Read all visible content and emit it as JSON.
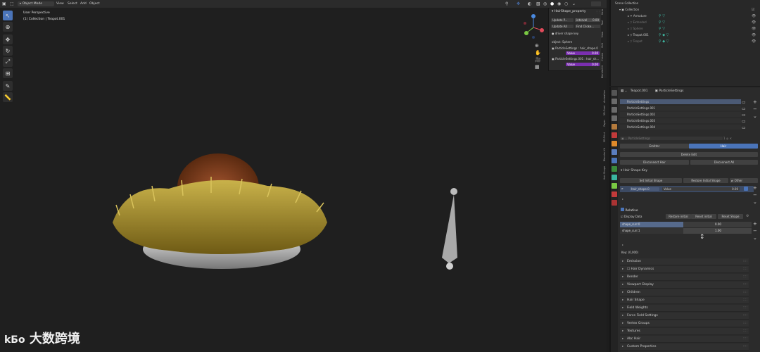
{
  "header": {
    "mode": "Object Mode",
    "menu": [
      "View",
      "Select",
      "Add",
      "Object"
    ]
  },
  "viewport": {
    "perspective": "User Perspective",
    "context": "(1) Collection | Teapot.001",
    "tools": [
      "select-icon",
      "cursor-icon",
      "move-icon",
      "rotate-icon",
      "scale-icon",
      "transform-icon",
      "annotate-icon",
      "measure-icon"
    ]
  },
  "npanel": {
    "title": "HairShape_property",
    "update_btn": "Update P...",
    "interval": "interval",
    "interval_val": "0.00",
    "update_all": "Update All",
    "find_clicked": "Find Clicke...",
    "driver": "driver shape key",
    "object": "object: Sphere",
    "ps1_label": "ParticleSettings : hair_shape.0",
    "value1_label": "Value",
    "value1": "0.00",
    "ps2_label": "ParticleSettings.001 : hair_sh...",
    "value2_label": "Value",
    "value2": "0.00",
    "tabs": [
      "Item",
      "Tool",
      "View",
      "Edit",
      "Create",
      "BlenderKit"
    ]
  },
  "outliner": {
    "scene": "Scene Collection",
    "rows": [
      {
        "name": "Collection",
        "dim": false,
        "indent": 0
      },
      {
        "name": "Armature",
        "dim": false,
        "indent": 1
      },
      {
        "name": "Extended",
        "dim": true,
        "indent": 1
      },
      {
        "name": "Sphere",
        "dim": true,
        "indent": 1
      },
      {
        "name": "Teapot.001",
        "dim": false,
        "indent": 1
      },
      {
        "name": "Teapot",
        "dim": true,
        "indent": 1
      }
    ]
  },
  "properties": {
    "object": "Teapot.001",
    "data": "ParticleSettings",
    "psys": [
      "ParticleSettings",
      "ParticleSettings.001",
      "ParticleSettings.002",
      "ParticleSettings.003",
      "ParticleSettings.004"
    ],
    "settings_name": "ParticleSettings",
    "emitter": "Emitter",
    "hair": "Hair",
    "delete_edit": "Delete Edit",
    "disconnect_hair": "Disconnect Hair",
    "disconnect_all": "Disconnect All",
    "hair_shape_key": "Hair Shape Key",
    "set_initial": "Set Initial Shape",
    "restore_initial": "Restore Initial Shape",
    "other": "Other",
    "key_name": "hair_shape.0",
    "key_value_label": "Value",
    "key_value": "0.00",
    "relative": "Relative",
    "display_data": "Display Data",
    "restore_initial2": "Restore initial",
    "reset_initial": "Reset initial",
    "reset_shape": "Reset Shape",
    "shape_rows": [
      {
        "name": "shape_curr.0",
        "value": "0.00"
      },
      {
        "name": "shape_curr.1",
        "value": "1.00"
      }
    ],
    "key_count": "Key: (0,000)",
    "sections": [
      "Emission",
      "Hair Dynamics",
      "Render",
      "Viewport Display",
      "Children",
      "Hair Shape",
      "Field Weights",
      "Force Field Settings",
      "Vertex Groups",
      "Textures",
      "Abc Hair",
      "Custom Properties"
    ],
    "tabs": [
      "Animation",
      "3D-Coat",
      "Paper",
      "3D-Print",
      "Blender Kit",
      "Hair Shape"
    ]
  },
  "watermark": "大数跨境",
  "colors": {
    "accent": "#4a74b9",
    "purple": "#7a2fb0",
    "bg": "#1f1f1f"
  }
}
